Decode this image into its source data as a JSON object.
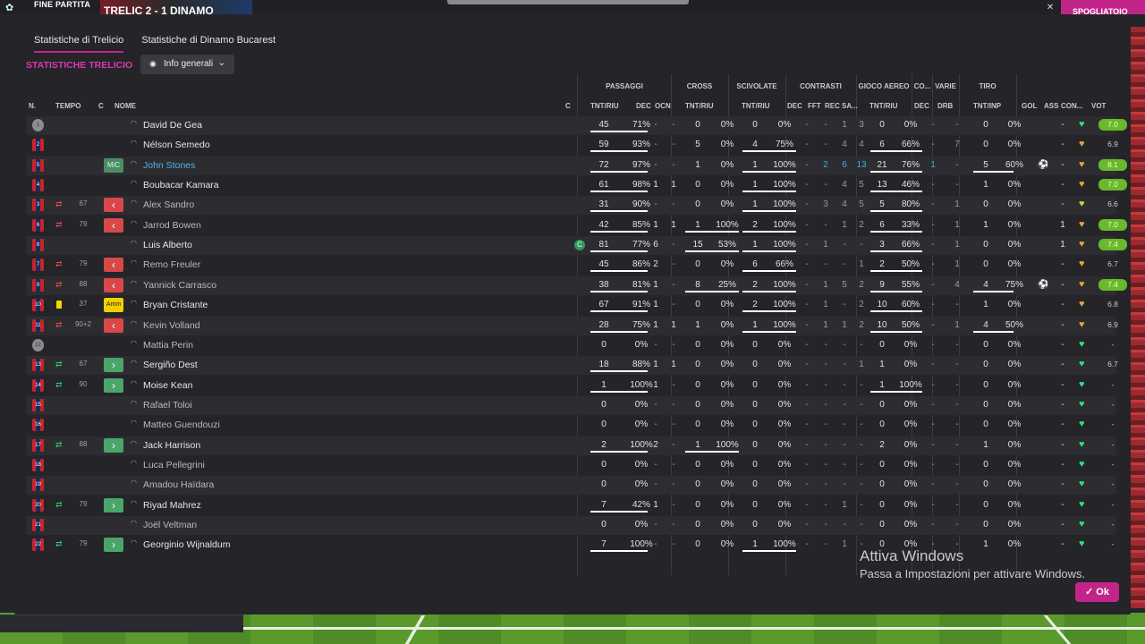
{
  "topbar": {
    "title": "FINE PARTITA",
    "score_text": "TRELIC 2 - 1 DINAMO",
    "close_icon": "close-icon",
    "pink_button": "SPOGLIATOIO"
  },
  "tabs": [
    {
      "label": "Statistiche di Trelicio",
      "active": true
    },
    {
      "label": "Statistiche di Dinamo Bucarest",
      "active": false
    }
  ],
  "heading": "STATISTICHE TRELICIO",
  "dropdown": {
    "label": "Info generali",
    "icon": "eye-icon"
  },
  "columns": {
    "n": "N.",
    "tempo": "TEMPO",
    "c": "C",
    "nome": "NOME",
    "capt": "C",
    "passaggi_sub": "TNT/RIU",
    "dec": "DEC",
    "ocn": "OCN",
    "cross_sub": "TNT/RIU",
    "scivolate_sub": "TNT/RIU",
    "c_dec": "DEC",
    "c_fft": "FFT",
    "c_rec": "REC",
    "c_sa": "SA...",
    "aereo_sub": "TNT/RIU",
    "co_dec": "DEC",
    "drb": "DRB",
    "tiro_sub": "TNT/INP",
    "gol": "GOL",
    "ass": "ASS",
    "con": "CON...",
    "vot": "VOT"
  },
  "groups": {
    "passaggi": "PASSAGGI",
    "cross": "CROSS",
    "scivolate": "SCIVOLATE",
    "contrasti": "CONTRASTI",
    "aereo": "GIOCO AEREO",
    "co": "CO...",
    "varie": "VARIE",
    "tiro": "TIRO"
  },
  "players": [
    {
      "n": "1",
      "gk": true,
      "sub": "",
      "min": "",
      "badge": "",
      "name": "David De Gea",
      "style": "",
      "capt": "",
      "p": [
        "45",
        "71%"
      ],
      "pb": 71,
      "dec": "-",
      "ocn": "-",
      "cr": [
        "0",
        "0%"
      ],
      "crb": 0,
      "sc": [
        "0",
        "0%"
      ],
      "scb": 0,
      "ct": [
        "-",
        "-",
        "1",
        "3"
      ],
      "ae": [
        "0",
        "0%"
      ],
      "aeb": 0,
      "codec": "-",
      "drb": "-",
      "ti": [
        "0",
        "0%"
      ],
      "tib": 0,
      "gol": "",
      "ass": "-",
      "heart": "green",
      "vot": "7.0",
      "vg": true
    },
    {
      "n": "2",
      "gk": false,
      "sub": "",
      "min": "",
      "badge": "",
      "name": "Nélson Semedo",
      "style": "",
      "capt": "",
      "p": [
        "59",
        "93%"
      ],
      "pb": 93,
      "dec": "-",
      "ocn": "-",
      "cr": [
        "5",
        "0%"
      ],
      "crb": 0,
      "sc": [
        "4",
        "75%"
      ],
      "scb": 75,
      "ct": [
        "-",
        "-",
        "4",
        "4"
      ],
      "ae": [
        "6",
        "66%"
      ],
      "aeb": 66,
      "codec": "-",
      "drb": "7",
      "ti": [
        "0",
        "0%"
      ],
      "tib": 0,
      "gol": "",
      "ass": "-",
      "heart": "orange",
      "vot": "6.9",
      "vg": false
    },
    {
      "n": "5",
      "gk": false,
      "sub": "",
      "min": "",
      "badge": "MiC",
      "name": "John Stones",
      "style": "link",
      "capt": "",
      "p": [
        "72",
        "97%"
      ],
      "pb": 97,
      "dec": "-",
      "ocn": "-",
      "cr": [
        "1",
        "0%"
      ],
      "crb": 0,
      "sc": [
        "1",
        "100%"
      ],
      "scb": 100,
      "ct": [
        "-",
        "2",
        "6",
        "13"
      ],
      "ae": [
        "21",
        "76%"
      ],
      "aeb": 76,
      "codec": "1",
      "drb": "-",
      "ti": [
        "5",
        "60%"
      ],
      "tib": 60,
      "gol": "ball",
      "ass": "-",
      "heart": "orange",
      "vot": "8.1",
      "vg": true
    },
    {
      "n": "4",
      "gk": false,
      "sub": "",
      "min": "",
      "badge": "",
      "name": "Boubacar Kamara",
      "style": "",
      "capt": "",
      "p": [
        "61",
        "98%"
      ],
      "pb": 98,
      "dec": "1",
      "ocn": "1",
      "cr": [
        "0",
        "0%"
      ],
      "crb": 0,
      "sc": [
        "1",
        "100%"
      ],
      "scb": 100,
      "ct": [
        "-",
        "-",
        "4",
        "5"
      ],
      "ae": [
        "13",
        "46%"
      ],
      "aeb": 46,
      "codec": "-",
      "drb": "-",
      "ti": [
        "1",
        "0%"
      ],
      "tib": 0,
      "gol": "",
      "ass": "-",
      "heart": "orange",
      "vot": "7.0",
      "vg": true
    },
    {
      "n": "3",
      "gk": false,
      "sub": "out",
      "min": "67",
      "badge": "out",
      "name": "Alex Sandro",
      "style": "dim",
      "capt": "",
      "p": [
        "31",
        "90%"
      ],
      "pb": 90,
      "dec": "-",
      "ocn": "-",
      "cr": [
        "0",
        "0%"
      ],
      "crb": 0,
      "sc": [
        "1",
        "100%"
      ],
      "scb": 100,
      "ct": [
        "-",
        "3",
        "4",
        "5"
      ],
      "ae": [
        "5",
        "80%"
      ],
      "aeb": 80,
      "codec": "-",
      "drb": "1",
      "ti": [
        "0",
        "0%"
      ],
      "tib": 0,
      "gol": "",
      "ass": "-",
      "heart": "yellow",
      "vot": "6.6",
      "vg": false
    },
    {
      "n": "6",
      "gk": false,
      "sub": "out",
      "min": "79",
      "badge": "out",
      "name": "Jarrod Bowen",
      "style": "dim",
      "capt": "",
      "p": [
        "42",
        "85%"
      ],
      "pb": 85,
      "dec": "1",
      "ocn": "1",
      "cr": [
        "1",
        "100%"
      ],
      "crb": 100,
      "sc": [
        "2",
        "100%"
      ],
      "scb": 100,
      "ct": [
        "-",
        "-",
        "1",
        "2"
      ],
      "ae": [
        "6",
        "33%"
      ],
      "aeb": 33,
      "codec": "-",
      "drb": "1",
      "ti": [
        "1",
        "0%"
      ],
      "tib": 0,
      "gol": "",
      "ass": "1",
      "heart": "orange",
      "vot": "7.0",
      "vg": true
    },
    {
      "n": "8",
      "gk": false,
      "sub": "",
      "min": "",
      "badge": "",
      "name": "Luis Alberto",
      "style": "",
      "capt": "C",
      "p": [
        "81",
        "77%"
      ],
      "pb": 77,
      "dec": "6",
      "ocn": "-",
      "cr": [
        "15",
        "53%"
      ],
      "crb": 53,
      "sc": [
        "1",
        "100%"
      ],
      "scb": 100,
      "ct": [
        "-",
        "1",
        "-",
        "-"
      ],
      "ae": [
        "3",
        "66%"
      ],
      "aeb": 66,
      "codec": "-",
      "drb": "1",
      "ti": [
        "0",
        "0%"
      ],
      "tib": 0,
      "gol": "",
      "ass": "1",
      "heart": "orange",
      "vot": "7.4",
      "vg": true
    },
    {
      "n": "7",
      "gk": false,
      "sub": "out",
      "min": "79",
      "badge": "out",
      "name": "Remo Freuler",
      "style": "dim",
      "capt": "",
      "p": [
        "45",
        "86%"
      ],
      "pb": 86,
      "dec": "2",
      "ocn": "-",
      "cr": [
        "0",
        "0%"
      ],
      "crb": 0,
      "sc": [
        "6",
        "66%"
      ],
      "scb": 66,
      "ct": [
        "-",
        "-",
        "-",
        "1"
      ],
      "ae": [
        "2",
        "50%"
      ],
      "aeb": 50,
      "codec": "-",
      "drb": "1",
      "ti": [
        "0",
        "0%"
      ],
      "tib": 0,
      "gol": "",
      "ass": "-",
      "heart": "orange",
      "vot": "6.7",
      "vg": false
    },
    {
      "n": "9",
      "gk": false,
      "sub": "out",
      "min": "88",
      "badge": "out",
      "name": "Yannick Carrasco",
      "style": "dim",
      "capt": "",
      "p": [
        "38",
        "81%"
      ],
      "pb": 81,
      "dec": "1",
      "ocn": "-",
      "cr": [
        "8",
        "25%"
      ],
      "crb": 25,
      "sc": [
        "2",
        "100%"
      ],
      "scb": 100,
      "ct": [
        "-",
        "1",
        "5",
        "2"
      ],
      "ae": [
        "9",
        "55%"
      ],
      "aeb": 55,
      "codec": "-",
      "drb": "4",
      "ti": [
        "4",
        "75%"
      ],
      "tib": 75,
      "gol": "ball",
      "ass": "-",
      "heart": "orange",
      "vot": "7.4",
      "vg": true
    },
    {
      "n": "10",
      "gk": false,
      "sub": "card",
      "min": "37",
      "badge": "amm",
      "name": "Bryan Cristante",
      "style": "",
      "capt": "",
      "p": [
        "67",
        "91%"
      ],
      "pb": 91,
      "dec": "1",
      "ocn": "-",
      "cr": [
        "0",
        "0%"
      ],
      "crb": 0,
      "sc": [
        "2",
        "100%"
      ],
      "scb": 100,
      "ct": [
        "-",
        "1",
        "-",
        "2"
      ],
      "ae": [
        "10",
        "60%"
      ],
      "aeb": 60,
      "codec": "-",
      "drb": "-",
      "ti": [
        "1",
        "0%"
      ],
      "tib": 0,
      "gol": "",
      "ass": "-",
      "heart": "orange",
      "vot": "6.8",
      "vg": false
    },
    {
      "n": "11",
      "gk": false,
      "sub": "out",
      "min": "90+2",
      "badge": "out",
      "name": "Kevin Volland",
      "style": "dim",
      "capt": "",
      "p": [
        "28",
        "75%"
      ],
      "pb": 75,
      "dec": "1",
      "ocn": "1",
      "cr": [
        "1",
        "0%"
      ],
      "crb": 0,
      "sc": [
        "1",
        "100%"
      ],
      "scb": 100,
      "ct": [
        "-",
        "1",
        "1",
        "2"
      ],
      "ae": [
        "10",
        "50%"
      ],
      "aeb": 50,
      "codec": "-",
      "drb": "1",
      "ti": [
        "4",
        "50%"
      ],
      "tib": 50,
      "gol": "",
      "ass": "-",
      "heart": "orange",
      "vot": "6.9",
      "vg": false
    },
    {
      "n": "12",
      "gk": true,
      "sub": "",
      "min": "",
      "badge": "",
      "name": "Mattia Perin",
      "style": "dim",
      "capt": "",
      "p": [
        "0",
        "0%"
      ],
      "pb": 0,
      "dec": "-",
      "ocn": "-",
      "cr": [
        "0",
        "0%"
      ],
      "crb": 0,
      "sc": [
        "0",
        "0%"
      ],
      "scb": 0,
      "ct": [
        "-",
        "-",
        "-",
        "-"
      ],
      "ae": [
        "0",
        "0%"
      ],
      "aeb": 0,
      "codec": "-",
      "drb": "-",
      "ti": [
        "0",
        "0%"
      ],
      "tib": 0,
      "gol": "",
      "ass": "-",
      "heart": "green",
      "vot": "-",
      "vg": false
    },
    {
      "n": "13",
      "gk": false,
      "sub": "in",
      "min": "67",
      "badge": "in",
      "name": "Sergiño Dest",
      "style": "",
      "capt": "",
      "p": [
        "18",
        "88%"
      ],
      "pb": 88,
      "dec": "1",
      "ocn": "1",
      "cr": [
        "0",
        "0%"
      ],
      "crb": 0,
      "sc": [
        "0",
        "0%"
      ],
      "scb": 0,
      "ct": [
        "-",
        "-",
        "-",
        "1"
      ],
      "ae": [
        "1",
        "0%"
      ],
      "aeb": 0,
      "codec": "-",
      "drb": "-",
      "ti": [
        "0",
        "0%"
      ],
      "tib": 0,
      "gol": "",
      "ass": "-",
      "heart": "green",
      "vot": "6.7",
      "vg": false
    },
    {
      "n": "14",
      "gk": false,
      "sub": "in",
      "min": "90",
      "badge": "in",
      "name": "Moise Kean",
      "style": "",
      "capt": "",
      "p": [
        "1",
        "100%"
      ],
      "pb": 100,
      "dec": "1",
      "ocn": "-",
      "cr": [
        "0",
        "0%"
      ],
      "crb": 0,
      "sc": [
        "0",
        "0%"
      ],
      "scb": 0,
      "ct": [
        "-",
        "-",
        "-",
        "-"
      ],
      "ae": [
        "1",
        "100%"
      ],
      "aeb": 100,
      "codec": "-",
      "drb": "-",
      "ti": [
        "0",
        "0%"
      ],
      "tib": 0,
      "gol": "",
      "ass": "-",
      "heart": "green",
      "vot": "-",
      "vg": false
    },
    {
      "n": "15",
      "gk": false,
      "sub": "",
      "min": "",
      "badge": "",
      "name": "Rafael Toloi",
      "style": "dim",
      "capt": "",
      "p": [
        "0",
        "0%"
      ],
      "pb": 0,
      "dec": "-",
      "ocn": "-",
      "cr": [
        "0",
        "0%"
      ],
      "crb": 0,
      "sc": [
        "0",
        "0%"
      ],
      "scb": 0,
      "ct": [
        "-",
        "-",
        "-",
        "-"
      ],
      "ae": [
        "0",
        "0%"
      ],
      "aeb": 0,
      "codec": "-",
      "drb": "-",
      "ti": [
        "0",
        "0%"
      ],
      "tib": 0,
      "gol": "",
      "ass": "-",
      "heart": "green",
      "vot": "-",
      "vg": false
    },
    {
      "n": "16",
      "gk": false,
      "sub": "",
      "min": "",
      "badge": "",
      "name": "Matteo Guendouzi",
      "style": "dim",
      "capt": "",
      "p": [
        "0",
        "0%"
      ],
      "pb": 0,
      "dec": "-",
      "ocn": "-",
      "cr": [
        "0",
        "0%"
      ],
      "crb": 0,
      "sc": [
        "0",
        "0%"
      ],
      "scb": 0,
      "ct": [
        "-",
        "-",
        "-",
        "-"
      ],
      "ae": [
        "0",
        "0%"
      ],
      "aeb": 0,
      "codec": "-",
      "drb": "-",
      "ti": [
        "0",
        "0%"
      ],
      "tib": 0,
      "gol": "",
      "ass": "-",
      "heart": "green",
      "vot": "-",
      "vg": false
    },
    {
      "n": "17",
      "gk": false,
      "sub": "in",
      "min": "88",
      "badge": "in",
      "name": "Jack Harrison",
      "style": "",
      "capt": "",
      "p": [
        "2",
        "100%"
      ],
      "pb": 100,
      "dec": "2",
      "ocn": "-",
      "cr": [
        "1",
        "100%"
      ],
      "crb": 100,
      "sc": [
        "0",
        "0%"
      ],
      "scb": 0,
      "ct": [
        "-",
        "-",
        "-",
        "-"
      ],
      "ae": [
        "2",
        "0%"
      ],
      "aeb": 0,
      "codec": "-",
      "drb": "-",
      "ti": [
        "1",
        "0%"
      ],
      "tib": 0,
      "gol": "",
      "ass": "-",
      "heart": "green",
      "vot": "-",
      "vg": false
    },
    {
      "n": "18",
      "gk": false,
      "sub": "",
      "min": "",
      "badge": "",
      "name": "Luca Pellegrini",
      "style": "dim",
      "capt": "",
      "p": [
        "0",
        "0%"
      ],
      "pb": 0,
      "dec": "-",
      "ocn": "-",
      "cr": [
        "0",
        "0%"
      ],
      "crb": 0,
      "sc": [
        "0",
        "0%"
      ],
      "scb": 0,
      "ct": [
        "-",
        "-",
        "-",
        "-"
      ],
      "ae": [
        "0",
        "0%"
      ],
      "aeb": 0,
      "codec": "-",
      "drb": "-",
      "ti": [
        "0",
        "0%"
      ],
      "tib": 0,
      "gol": "",
      "ass": "-",
      "heart": "green",
      "vot": "-",
      "vg": false
    },
    {
      "n": "19",
      "gk": false,
      "sub": "",
      "min": "",
      "badge": "",
      "name": "Amadou Haïdara",
      "style": "dim",
      "capt": "",
      "p": [
        "0",
        "0%"
      ],
      "pb": 0,
      "dec": "-",
      "ocn": "-",
      "cr": [
        "0",
        "0%"
      ],
      "crb": 0,
      "sc": [
        "0",
        "0%"
      ],
      "scb": 0,
      "ct": [
        "-",
        "-",
        "-",
        "-"
      ],
      "ae": [
        "0",
        "0%"
      ],
      "aeb": 0,
      "codec": "-",
      "drb": "-",
      "ti": [
        "0",
        "0%"
      ],
      "tib": 0,
      "gol": "",
      "ass": "-",
      "heart": "green",
      "vot": "-",
      "vg": false
    },
    {
      "n": "20",
      "gk": false,
      "sub": "in",
      "min": "79",
      "badge": "in",
      "name": "Riyad Mahrez",
      "style": "",
      "capt": "",
      "p": [
        "7",
        "42%"
      ],
      "pb": 42,
      "dec": "1",
      "ocn": "-",
      "cr": [
        "0",
        "0%"
      ],
      "crb": 0,
      "sc": [
        "0",
        "0%"
      ],
      "scb": 0,
      "ct": [
        "-",
        "-",
        "1",
        "-"
      ],
      "ae": [
        "0",
        "0%"
      ],
      "aeb": 0,
      "codec": "-",
      "drb": "-",
      "ti": [
        "0",
        "0%"
      ],
      "tib": 0,
      "gol": "",
      "ass": "-",
      "heart": "green",
      "vot": "-",
      "vg": false
    },
    {
      "n": "21",
      "gk": false,
      "sub": "",
      "min": "",
      "badge": "",
      "name": "Joël Veltman",
      "style": "dim",
      "capt": "",
      "p": [
        "0",
        "0%"
      ],
      "pb": 0,
      "dec": "-",
      "ocn": "-",
      "cr": [
        "0",
        "0%"
      ],
      "crb": 0,
      "sc": [
        "0",
        "0%"
      ],
      "scb": 0,
      "ct": [
        "-",
        "-",
        "-",
        "-"
      ],
      "ae": [
        "0",
        "0%"
      ],
      "aeb": 0,
      "codec": "-",
      "drb": "-",
      "ti": [
        "0",
        "0%"
      ],
      "tib": 0,
      "gol": "",
      "ass": "-",
      "heart": "green",
      "vot": "-",
      "vg": false
    },
    {
      "n": "22",
      "gk": false,
      "sub": "in",
      "min": "79",
      "badge": "in",
      "name": "Georginio Wijnaldum",
      "style": "",
      "capt": "",
      "p": [
        "7",
        "100%"
      ],
      "pb": 100,
      "dec": "-",
      "ocn": "-",
      "cr": [
        "0",
        "0%"
      ],
      "crb": 0,
      "sc": [
        "1",
        "100%"
      ],
      "scb": 100,
      "ct": [
        "-",
        "-",
        "1",
        "-"
      ],
      "ae": [
        "0",
        "0%"
      ],
      "aeb": 0,
      "codec": "-",
      "drb": "-",
      "ti": [
        "1",
        "0%"
      ],
      "tib": 0,
      "gol": "",
      "ass": "-",
      "heart": "green",
      "vot": "-",
      "vg": false
    }
  ],
  "badge_text": {
    "mic": "MiC",
    "amm": "Amm"
  },
  "capt_icon_text": "C",
  "watermark": {
    "line1": "Attiva Windows",
    "line2": "Passa a Impostazioni per attivare Windows."
  },
  "ok_button": "Ok",
  "colors": {
    "accent": "#c2258a",
    "rating_green": "#6ab82c",
    "heart_green": "#2ee07a",
    "heart_orange": "#e8a33a",
    "heart_yellow": "#c8d43a"
  }
}
